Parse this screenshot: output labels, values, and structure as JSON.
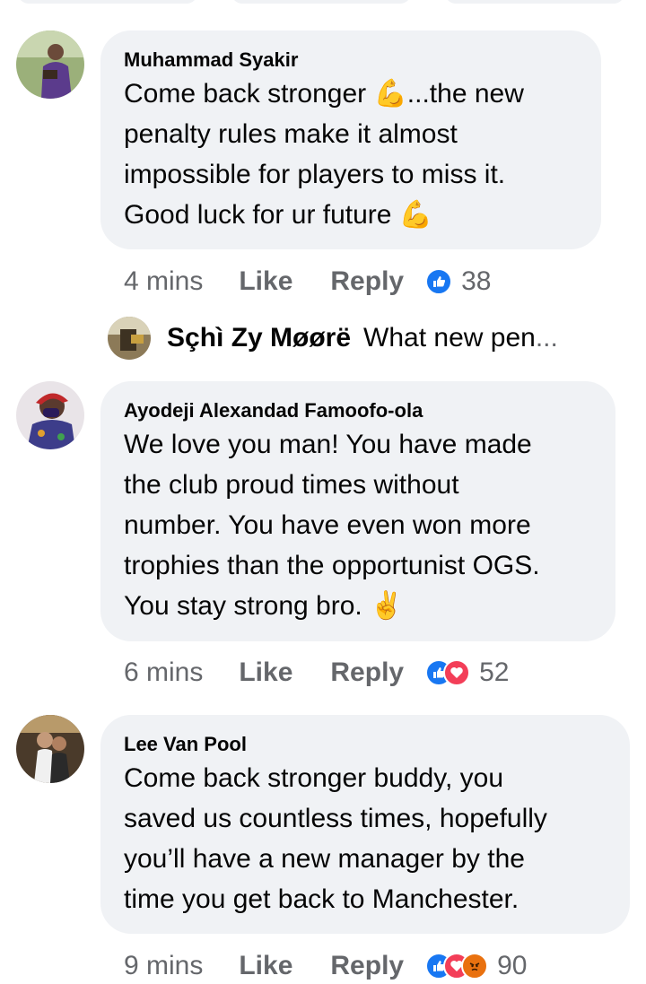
{
  "colors": {
    "bubble": "#f0f2f5",
    "meta_text": "#65676b",
    "like_blue": "#1877f2",
    "love_red": "#f33e58",
    "angry_orange": "#e9710f"
  },
  "comments": [
    {
      "author": "Muhammad Syakir",
      "text": "Come back stronger 💪...the new\npenalty rules make it almost\nimpossible for players to miss it.\nGood luck for ur future 💪",
      "time": "4 mins",
      "like": "Like",
      "reply": "Reply",
      "reactions": [
        "like-icon"
      ],
      "reaction_count": "38"
    },
    {
      "author": "Ayodeji Alexandad Famoofo-ola",
      "text": "We love you man! You have made\nthe club proud times without\nnumber. You have even won more\ntrophies than the opportunist OGS.\nYou stay strong bro. ✌️",
      "time": "6 mins",
      "like": "Like",
      "reply": "Reply",
      "reactions": [
        "like-icon",
        "love-icon"
      ],
      "reaction_count": "52"
    },
    {
      "author": "Lee Van Pool",
      "text": "Come back stronger buddy, you\nsaved us countless times, hopefully\nyou’ll have a new manager by the\ntime you get back to Manchester.",
      "time": "9 mins",
      "like": "Like",
      "reply": "Reply",
      "reactions": [
        "like-icon",
        "love-icon",
        "angry-icon"
      ],
      "reaction_count": "90"
    }
  ],
  "reply_preview": {
    "author": "Sçhì Zy Møørë",
    "text": "What new pen",
    "ellipsis": "..."
  }
}
